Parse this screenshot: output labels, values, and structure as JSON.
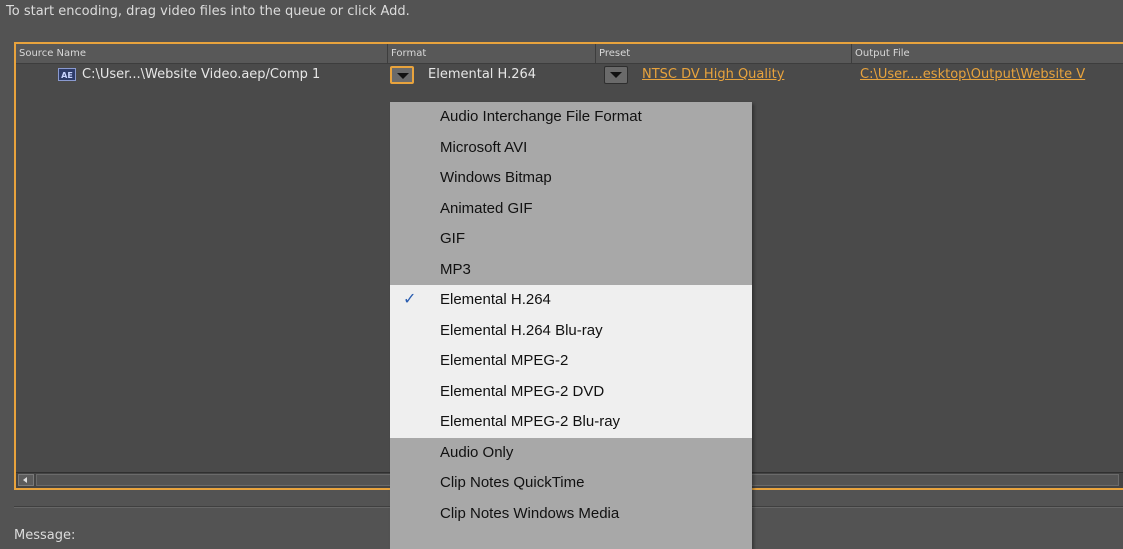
{
  "hint_text": "To start encoding, drag video files into the queue or click Add.",
  "queue": {
    "columns": [
      "Source Name",
      "Format",
      "Preset",
      "Output File"
    ],
    "row": {
      "icon": "AE",
      "source_name": "C:\\User...\\Website Video.aep/Comp 1",
      "format": "Elemental H.264",
      "preset": "NTSC DV High Quality",
      "output_file": "C:\\User....esktop\\Output\\Website V"
    }
  },
  "message_label": "Message:",
  "format_menu": {
    "items": [
      {
        "label": "Audio Interchange File Format",
        "checked": false
      },
      {
        "label": "Microsoft AVI",
        "checked": false
      },
      {
        "label": "Windows Bitmap",
        "checked": false
      },
      {
        "label": "Animated GIF",
        "checked": false
      },
      {
        "label": "GIF",
        "checked": false
      },
      {
        "label": "MP3",
        "checked": false
      },
      {
        "label": "Elemental H.264",
        "checked": true
      },
      {
        "label": "Elemental H.264 Blu-ray",
        "checked": false
      },
      {
        "label": "Elemental MPEG-2",
        "checked": false
      },
      {
        "label": "Elemental MPEG-2 DVD",
        "checked": false
      },
      {
        "label": "Elemental MPEG-2 Blu-ray",
        "checked": false
      },
      {
        "label": "Audio Only",
        "checked": false
      },
      {
        "label": "Clip Notes QuickTime",
        "checked": false
      },
      {
        "label": "Clip Notes Windows Media",
        "checked": false
      }
    ],
    "check_glyph": "✓"
  },
  "colors": {
    "accent": "#e8a33d",
    "panel": "#535353",
    "menu_bg": "#a8a8a8",
    "menu_highlight": "#efefef",
    "check": "#2a5db0"
  }
}
